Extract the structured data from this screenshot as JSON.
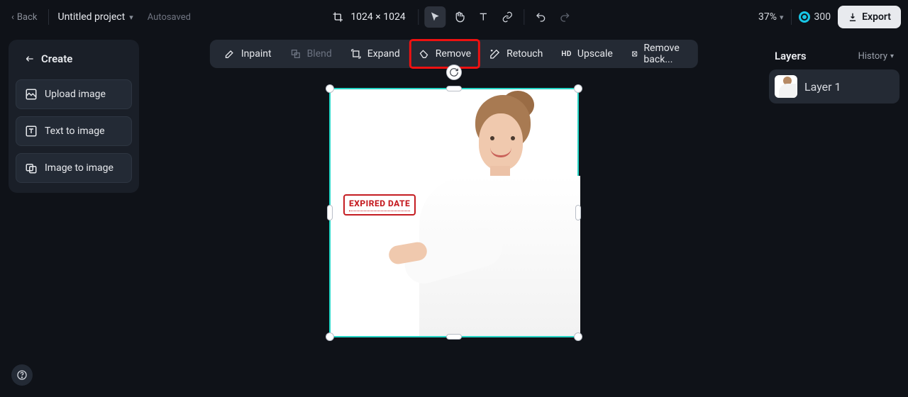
{
  "header": {
    "back": "Back",
    "project_name": "Untitled project",
    "autosaved": "Autosaved",
    "dimensions": "1024 × 1024",
    "zoom": "37%",
    "credits": "300",
    "export": "Export"
  },
  "create_panel": {
    "title": "Create",
    "upload": "Upload image",
    "text_to_image": "Text to image",
    "image_to_image": "Image to image"
  },
  "toolbar": {
    "inpaint": "Inpaint",
    "blend": "Blend",
    "expand": "Expand",
    "remove": "Remove",
    "retouch": "Retouch",
    "upscale": "Upscale",
    "remove_bg": "Remove back..."
  },
  "canvas": {
    "stamp_text": "EXPIRED DATE"
  },
  "layers_panel": {
    "title": "Layers",
    "history": "History",
    "layer1": "Layer 1"
  }
}
